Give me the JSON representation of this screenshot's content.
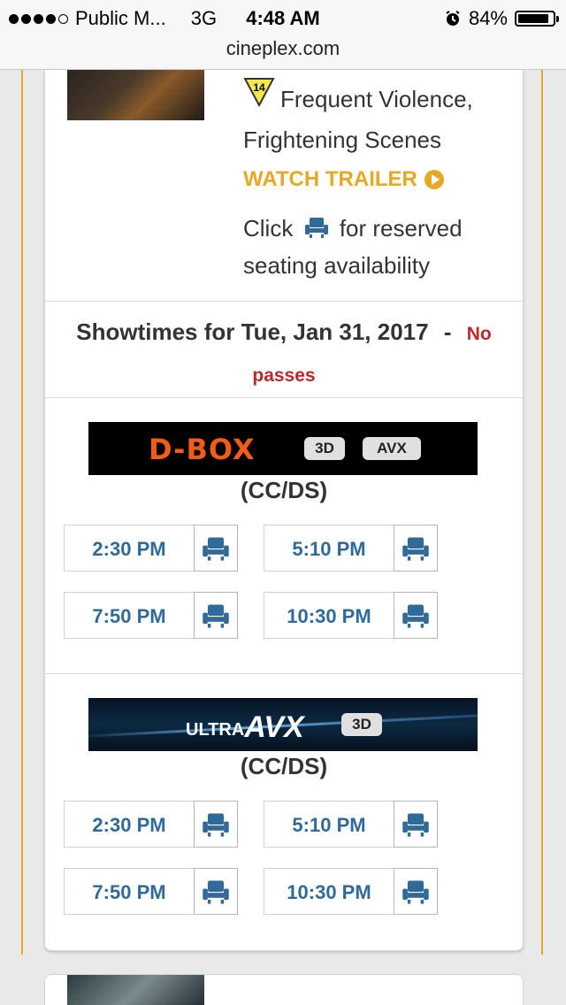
{
  "status_bar": {
    "carrier": "Public M...",
    "network": "3G",
    "time": "4:48 AM",
    "battery": "84%"
  },
  "browser": {
    "url": "cineplex.com"
  },
  "movie": {
    "rating_badge": "14",
    "advisory": "Frequent Violence, Frightening Scenes",
    "watch_trailer": "WATCH TRAILER",
    "seat_note_before": "Click",
    "seat_note_after": "for reserved seating availability"
  },
  "showtimes": {
    "title": "Showtimes for Tue, Jan 31, 2017",
    "separator": "-",
    "passes": "No passes"
  },
  "sections": [
    {
      "logo_text": "D-BOX",
      "badges": [
        "3D",
        "AVX"
      ],
      "format": "(CC/DS)",
      "times": [
        "2:30 PM",
        "5:10 PM",
        "7:50 PM",
        "10:30 PM"
      ]
    },
    {
      "logo_text": "ULTRA AVX",
      "logo_parts": [
        "ULTRA",
        "AVX"
      ],
      "badges": [
        "3D"
      ],
      "format": "(CC/DS)",
      "times": [
        "2:30 PM",
        "5:10 PM",
        "7:50 PM",
        "10:30 PM"
      ]
    }
  ],
  "icons": {
    "seat": "seat-icon",
    "play": "play-icon",
    "alarm": "alarm-icon",
    "battery": "battery-icon"
  },
  "colors": {
    "accent": "#e7a823",
    "link": "#2f6a9a",
    "alert": "#c0262d",
    "dbox": "#f25c14"
  }
}
